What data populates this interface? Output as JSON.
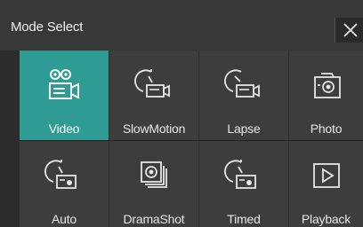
{
  "header": {
    "title": "Mode Select",
    "close_icon": "close-icon"
  },
  "modes": [
    {
      "label": "Video",
      "icon": "video-camera-icon",
      "selected": true
    },
    {
      "label": "SlowMotion",
      "icon": "slow-motion-icon",
      "selected": false
    },
    {
      "label": "Lapse",
      "icon": "lapse-icon",
      "selected": false
    },
    {
      "label": "Photo",
      "icon": "photo-camera-icon",
      "selected": false
    },
    {
      "label": "Auto",
      "icon": "auto-timer-icon",
      "selected": false
    },
    {
      "label": "DramaShot",
      "icon": "drama-shot-icon",
      "selected": false
    },
    {
      "label": "Timed",
      "icon": "timed-icon",
      "selected": false
    },
    {
      "label": "Playback",
      "icon": "playback-icon",
      "selected": false
    }
  ],
  "colors": {
    "accent": "#2f9b95",
    "tile": "#3d3d3d",
    "header": "#383838",
    "background": "#2c2c2c"
  }
}
